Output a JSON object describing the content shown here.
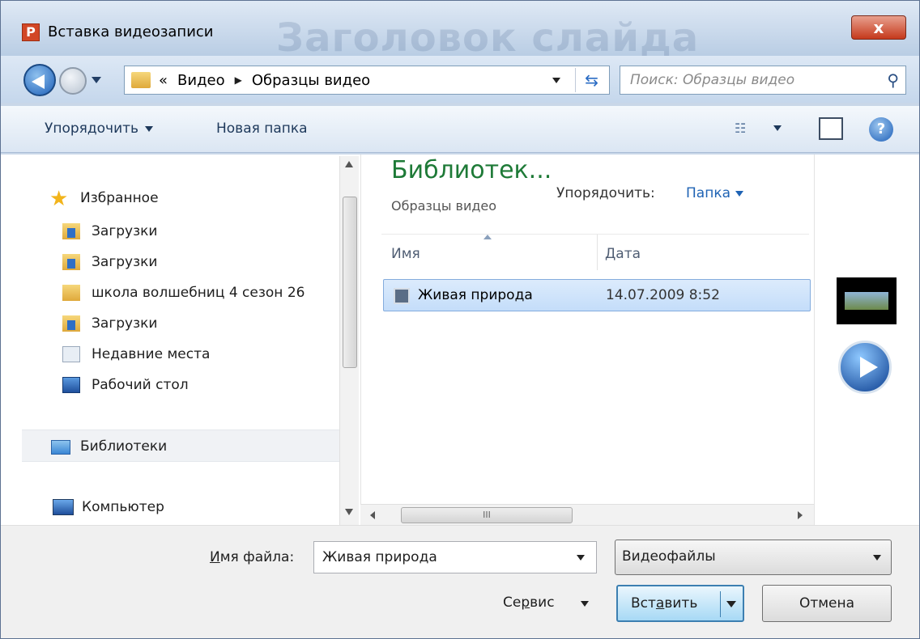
{
  "window": {
    "title": "Вставка видеозаписи",
    "background_title": "Заголовок слайда",
    "app_icon_letter": "P",
    "close_symbol": "x"
  },
  "address": {
    "crumb_prefix": "«",
    "segments": [
      "Видео",
      "Образцы видео"
    ],
    "search_placeholder": "Поиск: Образцы видео"
  },
  "toolbar": {
    "organize": "Упорядочить",
    "new_folder": "Новая папка",
    "help_symbol": "?"
  },
  "sidebar": {
    "favorites": "Избранное",
    "items": [
      "Загрузки",
      "Загрузки",
      "школа волшебниц 4 сезон 26",
      "Загрузки",
      "Недавние места",
      "Рабочий стол"
    ],
    "libraries": "Библиотеки",
    "computer": "Компьютер"
  },
  "content": {
    "library_title": "Библиотек...",
    "library_subtitle": "Образцы видео",
    "arrange_label": "Упорядочить:",
    "arrange_value": "Папка",
    "columns": {
      "name": "Имя",
      "date": "Дата"
    },
    "files": [
      {
        "name": "Живая природа",
        "date": "14.07.2009 8:52"
      }
    ],
    "hscroll_grip": "III"
  },
  "bottom": {
    "filename_label_pre": "И",
    "filename_label_rest": "мя файла:",
    "filename_value": "Живая природа",
    "filetype_value": "Видеофайлы",
    "tools_pre": "Се",
    "tools_u": "р",
    "tools_post": "вис",
    "insert_pre": "Вст",
    "insert_u": "а",
    "insert_post": "вить",
    "cancel": "Отмена"
  },
  "colors": {
    "library_title": "#1e7a37",
    "accent_blue": "#1f63b4",
    "selection": "#c4ddfa"
  }
}
